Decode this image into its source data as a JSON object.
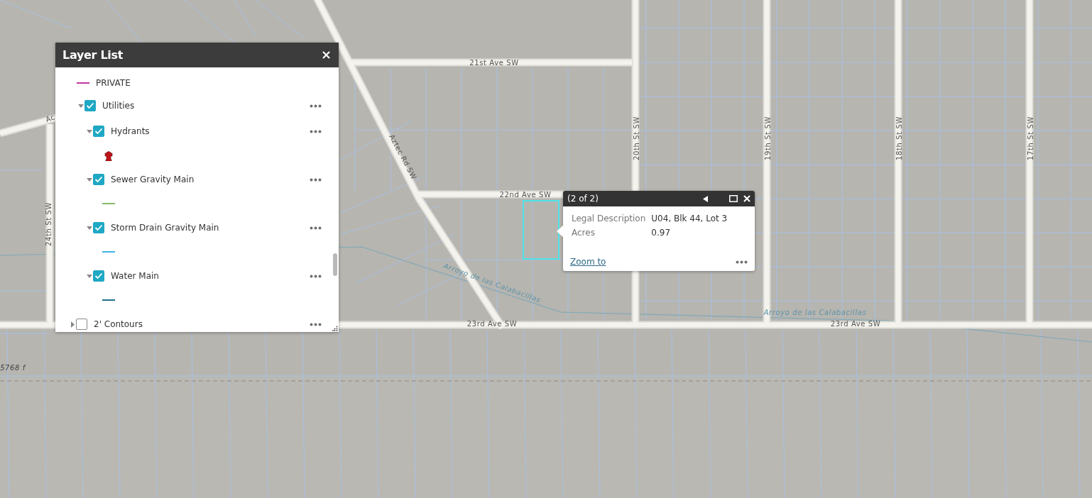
{
  "map": {
    "labels": [
      {
        "text": "21st Ave SW"
      },
      {
        "text": "Ac"
      },
      {
        "text": "Aztec Rd SW"
      },
      {
        "text": "22nd Ave SW"
      },
      {
        "text": "20th St SW"
      },
      {
        "text": "19th St SW"
      },
      {
        "text": "18th St SW"
      },
      {
        "text": "17th St SW"
      },
      {
        "text": "24th St SW"
      },
      {
        "text": "Arroyo de las Calabacillas"
      },
      {
        "text": "Arroyo de las Calabacillas"
      },
      {
        "text": "23rd Ave SW"
      },
      {
        "text": "23rd Ave SW"
      },
      {
        "text": "5768 f"
      }
    ]
  },
  "layer_list": {
    "title": "Layer List",
    "items": [
      {
        "kind": "line",
        "label": "PRIVATE",
        "color": "#c2359e"
      },
      {
        "kind": "layer",
        "label": "Utilities",
        "checked": true,
        "expanded": true,
        "children": [
          {
            "kind": "layer",
            "label": "Hydrants",
            "checked": true,
            "expanded": true,
            "children": [
              {
                "kind": "hydrant"
              }
            ]
          },
          {
            "kind": "layer",
            "label": "Sewer Gravity Main",
            "checked": true,
            "expanded": true,
            "children": [
              {
                "kind": "line",
                "color": "#86b86a"
              }
            ]
          },
          {
            "kind": "layer",
            "label": "Storm Drain Gravity Main",
            "checked": true,
            "expanded": true,
            "children": [
              {
                "kind": "line",
                "color": "#3cb4e6"
              }
            ]
          },
          {
            "kind": "layer",
            "label": "Water Main",
            "checked": true,
            "expanded": true,
            "children": [
              {
                "kind": "line",
                "color": "#1b6f8c"
              }
            ]
          }
        ]
      },
      {
        "kind": "layer",
        "label": "2' Contours",
        "checked": false,
        "expanded": false
      }
    ]
  },
  "popup": {
    "title": "(2 of 2)",
    "fields": [
      {
        "label": "Legal Description",
        "value": "U04, Blk 44, Lot 3"
      },
      {
        "label": "Acres",
        "value": "0.97"
      }
    ],
    "link": "Zoom to"
  }
}
